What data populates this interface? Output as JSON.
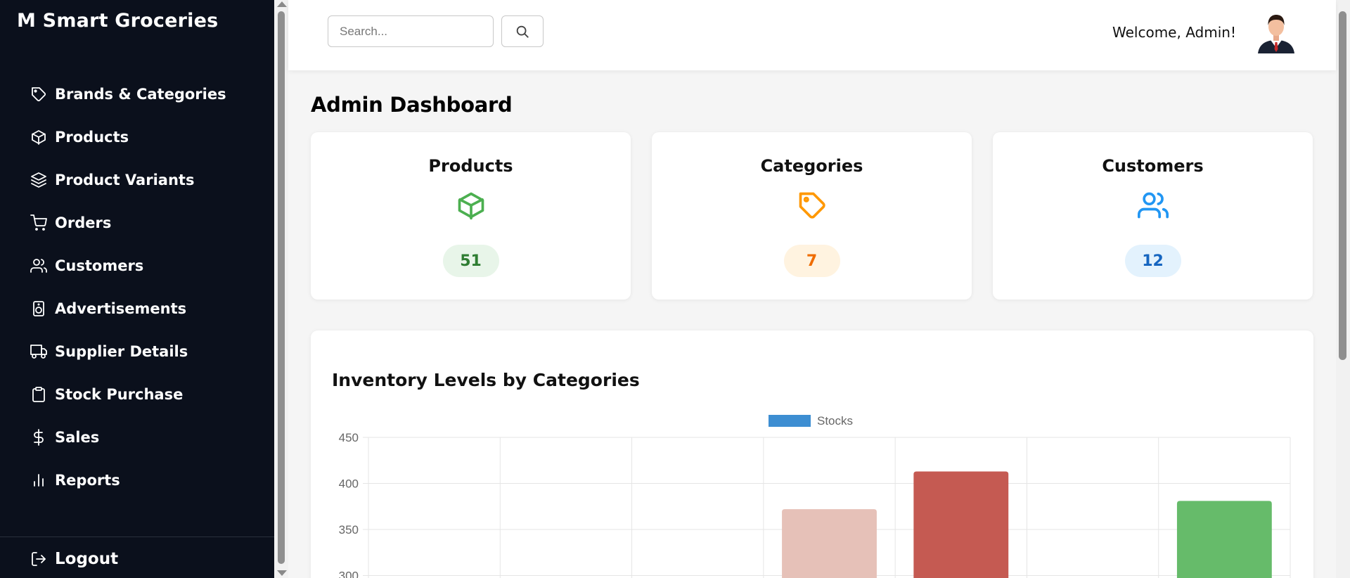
{
  "sidebar": {
    "brand": "M Smart Groceries",
    "items": [
      {
        "label": "Brands & Categories",
        "icon": "tag-icon"
      },
      {
        "label": "Products",
        "icon": "box-icon"
      },
      {
        "label": "Product Variants",
        "icon": "layers-icon"
      },
      {
        "label": "Orders",
        "icon": "cart-icon"
      },
      {
        "label": "Customers",
        "icon": "users-icon"
      },
      {
        "label": "Advertisements",
        "icon": "speaker-icon"
      },
      {
        "label": "Supplier Details",
        "icon": "truck-icon"
      },
      {
        "label": "Stock Purchase",
        "icon": "clipboard-icon"
      },
      {
        "label": "Sales",
        "icon": "dollar-icon"
      },
      {
        "label": "Reports",
        "icon": "bar-chart-icon"
      }
    ],
    "logout": "Logout"
  },
  "topbar": {
    "search_placeholder": "Search...",
    "welcome": "Welcome, Admin!"
  },
  "main": {
    "title": "Admin Dashboard",
    "cards": [
      {
        "title": "Products",
        "count": "51",
        "icon": "box-icon",
        "color": "#4caf50",
        "badge_bg": "#e8f5e9",
        "badge_fg": "#2e7d32"
      },
      {
        "title": "Categories",
        "count": "7",
        "icon": "tag-icon",
        "color": "#ff9800",
        "badge_bg": "#fff3e0",
        "badge_fg": "#ef6c00"
      },
      {
        "title": "Customers",
        "count": "12",
        "icon": "users-icon",
        "color": "#2196f3",
        "badge_bg": "#e3f2fd",
        "badge_fg": "#1565c0"
      }
    ],
    "chart_title": "Inventory Levels by Categories"
  },
  "chart_data": {
    "type": "bar",
    "series": [
      {
        "name": "Stocks",
        "color": "#3d8ed2"
      }
    ],
    "category_count": 7,
    "visible_values": [
      null,
      null,
      null,
      372,
      413,
      null,
      381
    ],
    "bar_colors": [
      null,
      null,
      null,
      "#e6c1b8",
      "#c55a52",
      null,
      "#66bb6a"
    ],
    "y_ticks": [
      450,
      400,
      350,
      300
    ],
    "ylim_visible": [
      300,
      450
    ]
  }
}
